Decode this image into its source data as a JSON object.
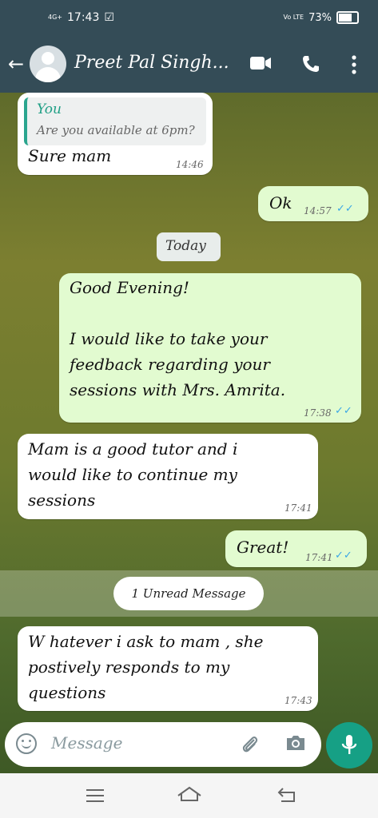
{
  "status": {
    "time": "17:43",
    "network": "4G+",
    "battery": "73%",
    "lte": "Vo LTE"
  },
  "header": {
    "contact_name": "Preet Pal Singh..."
  },
  "messages": [
    {
      "quote_author": "You",
      "quote_text": "Are you available at 6pm?",
      "text": "Sure mam",
      "time": "14:46"
    },
    {
      "text": "Ok",
      "time": "14:57"
    },
    {
      "text": "Good Evening!\n\nI would like to take your\nfeedback regarding your\nsessions with Mrs. Amrita.",
      "time": "17:38"
    },
    {
      "text": "Mam is a good tutor and i\nwould like to continue my\nsessions",
      "time": "17:41"
    },
    {
      "text": "Great!",
      "time": "17:41"
    },
    {
      "text": "W hatever i ask to mam , she\npostively responds to my\nquestions",
      "time": "17:43"
    }
  ],
  "date_chip": "Today",
  "unread_label": "1 Unread Message",
  "composer": {
    "placeholder": "Message"
  },
  "icons": [
    "back-arrow-icon",
    "avatar-icon",
    "video-call-icon",
    "phone-icon",
    "more-vertical-icon",
    "emoji-icon",
    "attach-icon",
    "camera-icon",
    "mic-icon",
    "menu-icon",
    "home-icon",
    "back-nav-icon"
  ],
  "colors": {
    "header": "#344c57",
    "outgoing": "#e2fbd0",
    "incoming": "#ffffff",
    "accent": "#16a085",
    "ticks": "#3aa7e6"
  }
}
